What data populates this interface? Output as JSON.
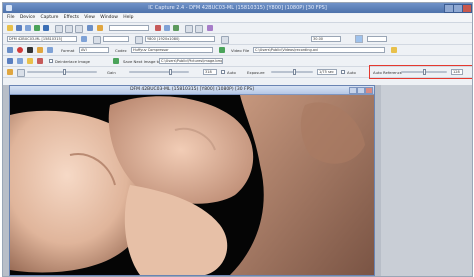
{
  "window": {
    "title": "IC Capture 2.4 - DFM 42BUC03-ML (15810315) [Y800] (1080P) [30 FPS]"
  },
  "menu": [
    "File",
    "Device",
    "Capture",
    "Effects",
    "View",
    "Window",
    "Help"
  ],
  "toolbar2": {
    "device": "DFM 42BUC03-ML [15810315]",
    "video_format": "Y800 (1920x1080)",
    "fps": "30.00"
  },
  "toolbar3": {
    "format_label": "Format",
    "format_value": "AVI",
    "codec_label": "Codec",
    "codec_value": "Huffyuv Compressor",
    "avi_label": "Video File",
    "avi_path": "C:\\Users\\Public\\Videos\\recording.avi"
  },
  "toolbar4": {
    "deinterlace_label": "Deinterlace Image",
    "save_label": "Save Next Image to",
    "save_path": "C:\\Users\\Public\\Pictures\\image.bmp"
  },
  "toolbar5": {
    "gain_label": "Gain",
    "gain_value": "318",
    "gain_auto": "Auto",
    "exposure_label": "Exposure",
    "exposure_value": "1/75 sec",
    "exposure_auto": "Auto",
    "auto_ref_label": "Auto Reference",
    "auto_ref_value": "128"
  },
  "subwindow": {
    "title": "DFM 42BUC03-ML (15810315) [Y800] (1080P) [30 FPS]"
  },
  "colors": {
    "highlight": "#e5392f"
  }
}
